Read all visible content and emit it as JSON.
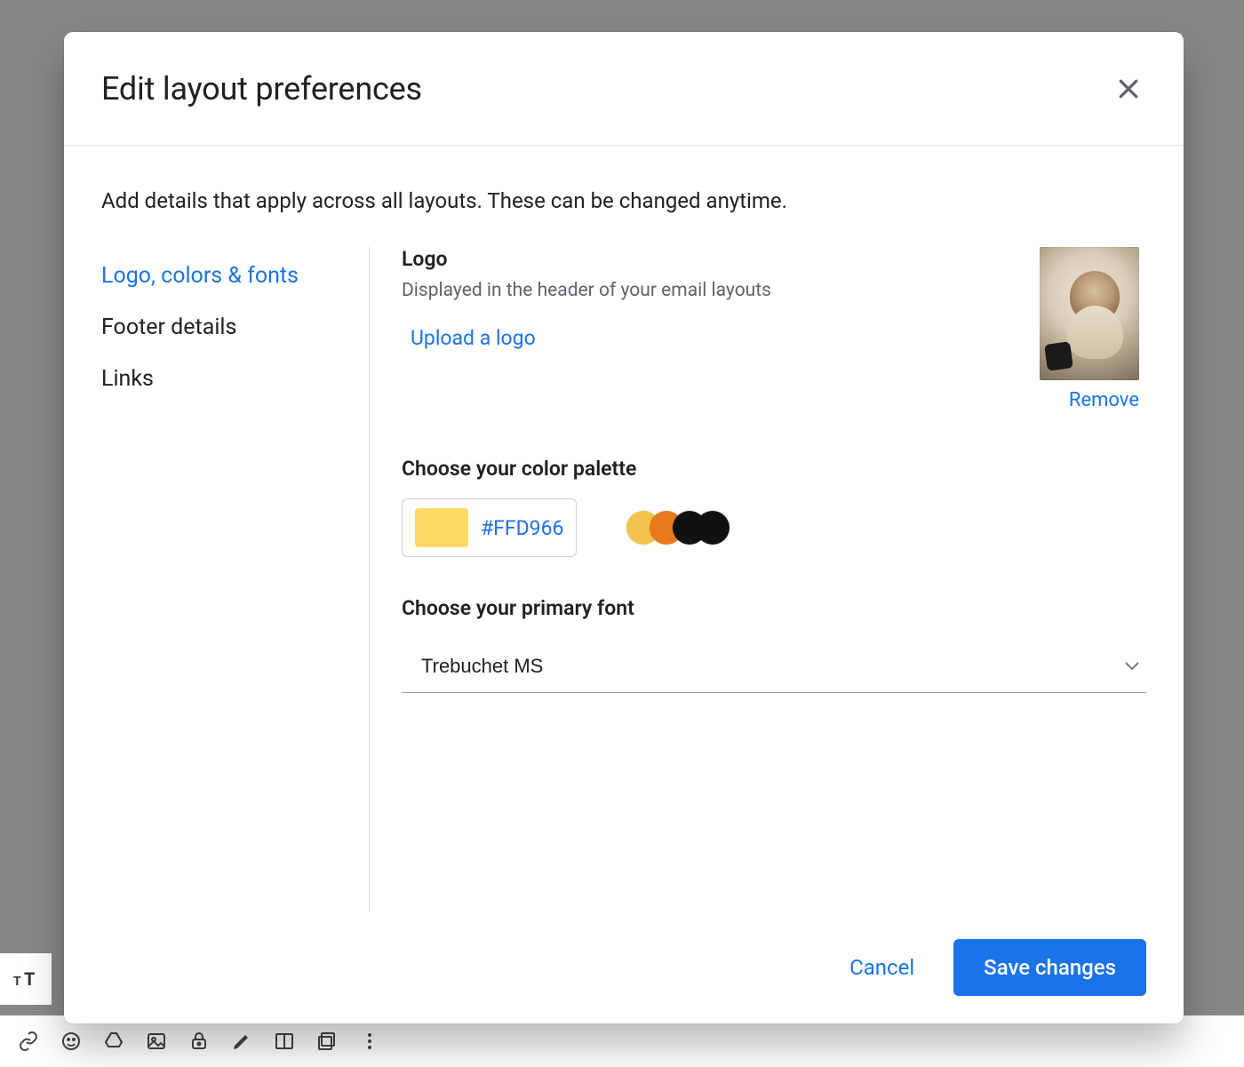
{
  "dialog": {
    "title": "Edit layout preferences",
    "intro": "Add details that apply across all layouts. These can be changed anytime."
  },
  "sidebar": {
    "items": [
      {
        "label": "Logo, colors & fonts",
        "active": true
      },
      {
        "label": "Footer details",
        "active": false
      },
      {
        "label": "Links",
        "active": false
      }
    ]
  },
  "logo": {
    "heading": "Logo",
    "description": "Displayed in the header of your email layouts",
    "upload_label": "Upload a logo",
    "remove_label": "Remove"
  },
  "palette": {
    "heading": "Choose your color palette",
    "selected_hex": "#FFD966",
    "swatch_color": "#FFD966",
    "dots": [
      "#F3C34B",
      "#E77A1C",
      "#111111",
      "#111111"
    ]
  },
  "font": {
    "heading": "Choose your primary font",
    "value": "Trebuchet MS"
  },
  "footer": {
    "cancel_label": "Cancel",
    "save_label": "Save changes"
  }
}
